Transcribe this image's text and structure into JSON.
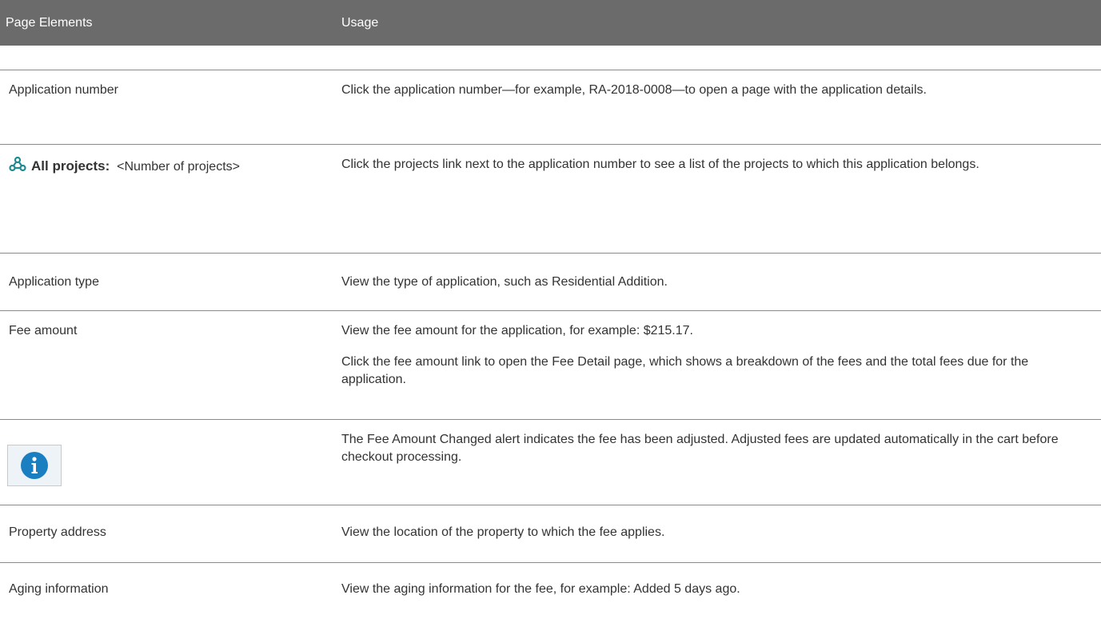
{
  "header": {
    "col1": "Page Elements",
    "col2": "Usage"
  },
  "rows": {
    "application_number": {
      "element": "Application number",
      "usage": "Click the application number—for example, RA-2018-0008—to open a page with the application details."
    },
    "all_projects": {
      "icon": "projects-icon",
      "label_bold": "All projects:",
      "label_rest": "<Number of projects>",
      "usage": "Click the projects link next to the application number to see a list of the projects to which this application belongs."
    },
    "application_type": {
      "element": "Application type",
      "usage": "View the type of application, such as Residential Addition."
    },
    "fee_amount": {
      "element": "Fee amount",
      "usage_1": "View the fee amount for the application, for example: $215.17.",
      "usage_2": "Click the fee amount link to open the Fee Detail page, which shows a breakdown of the fees and the total fees due for the application."
    },
    "fee_changed": {
      "icon": "info-icon",
      "usage": "The Fee Amount Changed alert indicates the fee has been adjusted. Adjusted fees are updated automatically in the cart before checkout processing."
    },
    "property_address": {
      "element": "Property address",
      "usage": "View the location of the property to which the fee applies."
    },
    "aging_information": {
      "element": "Aging information",
      "usage": "View the aging information for the fee, for example: Added 5 days ago."
    }
  },
  "colors": {
    "header_bg": "#6b6b6b",
    "header_text": "#ffffff",
    "icon_teal": "#1f8a8f",
    "info_blue": "#1a7fc1"
  }
}
